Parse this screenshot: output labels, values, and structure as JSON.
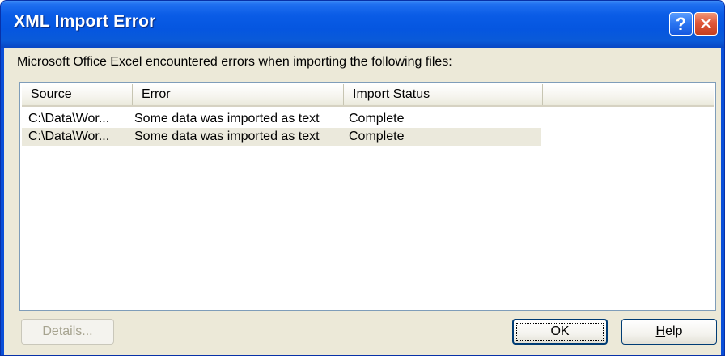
{
  "window": {
    "title": "XML Import Error",
    "help_glyph": "?",
    "close_glyph": "✕"
  },
  "message": "Microsoft Office Excel encountered errors when importing the following files:",
  "table": {
    "columns": [
      "Source",
      "Error",
      "Import Status",
      ""
    ],
    "rows": [
      {
        "source": "C:\\Data\\Wor...",
        "error": "Some data was imported as text",
        "status": "Complete"
      },
      {
        "source": "C:\\Data\\Wor...",
        "error": "Some data was imported as text",
        "status": "Complete"
      }
    ],
    "selected_row": 1
  },
  "buttons": {
    "details": "Details...",
    "ok": "OK",
    "help_first": "H",
    "help_rest": "elp"
  },
  "colors": {
    "titlebar": "#0556e0",
    "dialog_bg": "#ece9d8",
    "selection": "#ebe9dc",
    "close_button": "#e0583a"
  }
}
